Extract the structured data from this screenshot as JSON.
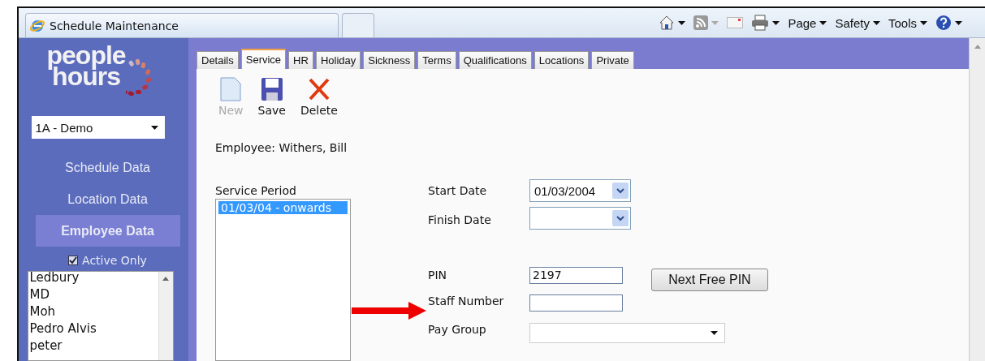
{
  "browser_tab": {
    "title": "Schedule Maintenance",
    "selected": true
  },
  "command_bar": [
    {
      "kind": "home",
      "disabled": false
    },
    {
      "kind": "feeds",
      "disabled": true
    },
    {
      "kind": "mail",
      "disabled": true
    },
    {
      "kind": "print",
      "disabled": false
    },
    {
      "kind": "menu",
      "label": "Page"
    },
    {
      "kind": "menu",
      "label": "Safety"
    },
    {
      "kind": "menu",
      "label": "Tools"
    },
    {
      "kind": "help",
      "disabled": false
    }
  ],
  "sidebar": {
    "logo": {
      "line_1": "people",
      "line_2": "hours"
    },
    "company_select": {
      "value": "1A - Demo"
    },
    "nav": [
      {
        "label": "Schedule Data",
        "selected": false
      },
      {
        "label": "Location Data",
        "selected": false
      },
      {
        "label": "Employee Data",
        "selected": true
      }
    ],
    "active_only": {
      "label": "Active Only",
      "checked": true
    },
    "employees": [
      "Ledbury",
      "MD",
      "Moh",
      "Pedro Alvis",
      "peter"
    ]
  },
  "tabs": [
    {
      "label": "Details",
      "selected": false
    },
    {
      "label": "Service",
      "selected": true
    },
    {
      "label": "HR",
      "selected": false
    },
    {
      "label": "Holiday",
      "selected": false
    },
    {
      "label": "Sickness",
      "selected": false
    },
    {
      "label": "Terms",
      "selected": false
    },
    {
      "label": "Qualifications",
      "selected": false
    },
    {
      "label": "Locations",
      "selected": false
    },
    {
      "label": "Private",
      "selected": false
    }
  ],
  "toolbar": [
    {
      "kind": "new",
      "label": "New",
      "disabled": true
    },
    {
      "kind": "save",
      "label": "Save",
      "disabled": false
    },
    {
      "kind": "delete",
      "label": "Delete",
      "disabled": false
    }
  ],
  "employee_line": "Employee: Withers, Bill",
  "service_period": {
    "label": "Service Period",
    "items": [
      {
        "label": "01/03/04 - onwards",
        "selected": true
      }
    ]
  },
  "form": {
    "start_date": {
      "label": "Start Date",
      "value": "01/03/2004"
    },
    "finish_date": {
      "label": "Finish Date"
    },
    "pin": {
      "label": "PIN",
      "value": "2197"
    },
    "next_free_pin": "Next Free PIN",
    "staff_number": {
      "label": "Staff Number"
    },
    "pay_group": {
      "label": "Pay Group"
    }
  }
}
